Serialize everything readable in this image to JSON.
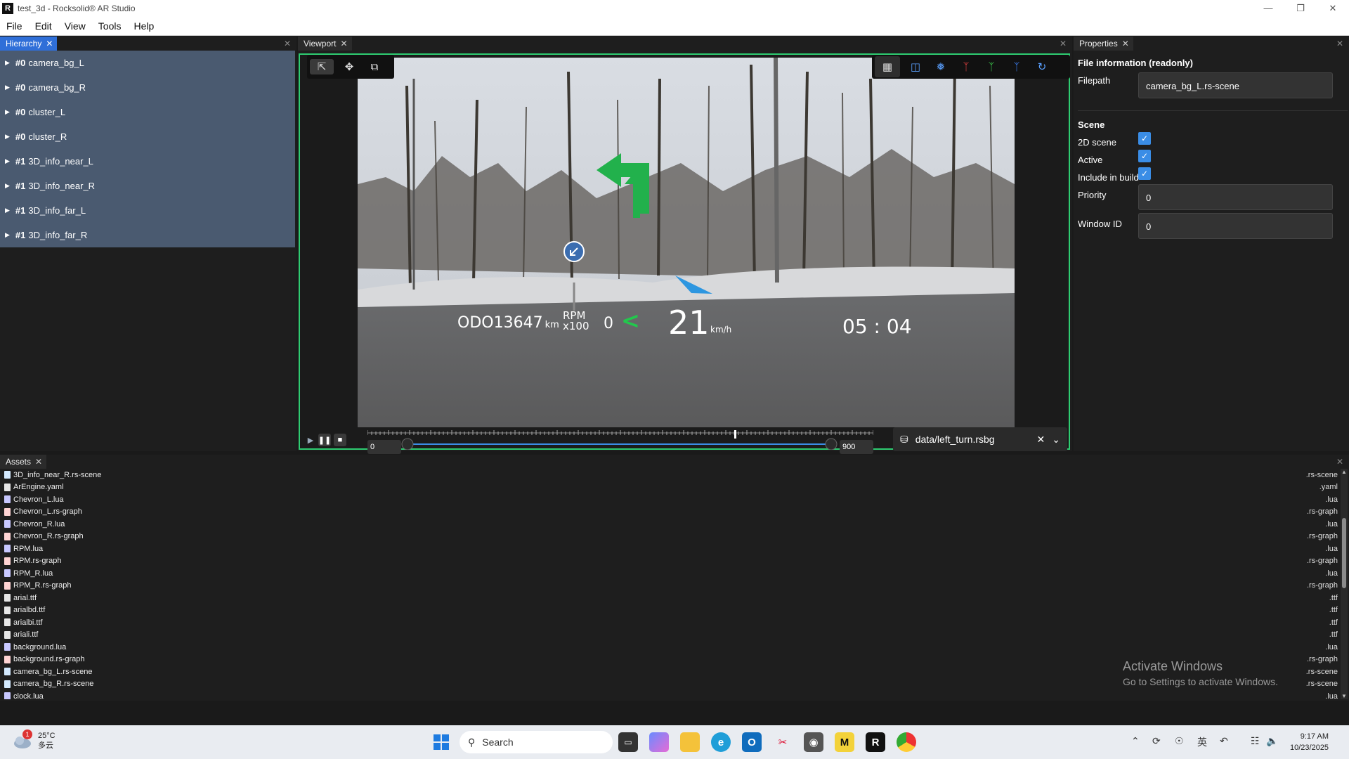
{
  "window": {
    "title": "test_3d - Rocksolid® AR Studio",
    "app_icon": "rocksolid-logo-icon",
    "controls": [
      "minimize",
      "restore",
      "close"
    ]
  },
  "menu": [
    "File",
    "Edit",
    "View",
    "Tools",
    "Help"
  ],
  "hierarchy": {
    "tab": "Hierarchy",
    "items": [
      {
        "idx": "#0",
        "name": "camera_bg_L"
      },
      {
        "idx": "#0",
        "name": "camera_bg_R"
      },
      {
        "idx": "#0",
        "name": "cluster_L"
      },
      {
        "idx": "#0",
        "name": "cluster_R"
      },
      {
        "idx": "#1",
        "name": "3D_info_near_L"
      },
      {
        "idx": "#1",
        "name": "3D_info_near_R"
      },
      {
        "idx": "#1",
        "name": "3D_info_far_L"
      },
      {
        "idx": "#1",
        "name": "3D_info_far_R"
      }
    ]
  },
  "viewport": {
    "tab": "Viewport",
    "hud": {
      "odo_label": "ODO",
      "odo_value": "13647",
      "odo_unit": "km",
      "rpm_label": "RPM",
      "rpm_scale": "x100",
      "rpm_value": "0",
      "chevron": "<",
      "speed": "21",
      "speed_unit": "km/h",
      "clock_h": "05",
      "clock_sep": ":",
      "clock_m": "04"
    },
    "playback": {
      "range_start": "0",
      "range_end": "900",
      "recording": "data/left_turn.rsbg"
    },
    "accent": "#2ecc71"
  },
  "properties": {
    "tab": "Properties",
    "file_info_heading": "File information (readonly)",
    "filepath_label": "Filepath",
    "filepath_value": "camera_bg_L.rs-scene",
    "scene_heading": "Scene",
    "scene_2d_label": "2D scene",
    "active_label": "Active",
    "include_label": "Include in build",
    "priority_label": "Priority",
    "priority_value": "0",
    "window_id_label": "Window ID",
    "window_id_value": "0"
  },
  "assets": {
    "tab": "Assets",
    "files": [
      {
        "name": "3D_info_near_R.rs-scene",
        "ext": ".rs-scene",
        "kind": "scene"
      },
      {
        "name": "ArEngine.yaml",
        "ext": ".yaml",
        "kind": "file"
      },
      {
        "name": "Chevron_L.lua",
        "ext": ".lua",
        "kind": "lua"
      },
      {
        "name": "Chevron_L.rs-graph",
        "ext": ".rs-graph",
        "kind": "graph"
      },
      {
        "name": "Chevron_R.lua",
        "ext": ".lua",
        "kind": "lua"
      },
      {
        "name": "Chevron_R.rs-graph",
        "ext": ".rs-graph",
        "kind": "graph"
      },
      {
        "name": "RPM.lua",
        "ext": ".lua",
        "kind": "lua"
      },
      {
        "name": "RPM.rs-graph",
        "ext": ".rs-graph",
        "kind": "graph"
      },
      {
        "name": "RPM_R.lua",
        "ext": ".lua",
        "kind": "lua"
      },
      {
        "name": "RPM_R.rs-graph",
        "ext": ".rs-graph",
        "kind": "graph"
      },
      {
        "name": "arial.ttf",
        "ext": ".ttf",
        "kind": "file"
      },
      {
        "name": "arialbd.ttf",
        "ext": ".ttf",
        "kind": "file"
      },
      {
        "name": "arialbi.ttf",
        "ext": ".ttf",
        "kind": "file"
      },
      {
        "name": "ariali.ttf",
        "ext": ".ttf",
        "kind": "file"
      },
      {
        "name": "background.lua",
        "ext": ".lua",
        "kind": "lua"
      },
      {
        "name": "background.rs-graph",
        "ext": ".rs-graph",
        "kind": "graph"
      },
      {
        "name": "camera_bg_L.rs-scene",
        "ext": ".rs-scene",
        "kind": "scene"
      },
      {
        "name": "camera_bg_R.rs-scene",
        "ext": ".rs-scene",
        "kind": "scene"
      },
      {
        "name": "clock.lua",
        "ext": ".lua",
        "kind": "lua"
      }
    ]
  },
  "watermark": {
    "line1": "Activate Windows",
    "line2": "Go to Settings to activate Windows."
  },
  "taskbar": {
    "weather_temp": "25°C",
    "weather_desc": "多云",
    "weather_badge": "1",
    "search_placeholder": "Search",
    "ime": "英",
    "time": "9:17 AM",
    "date": "10/23/2025"
  }
}
